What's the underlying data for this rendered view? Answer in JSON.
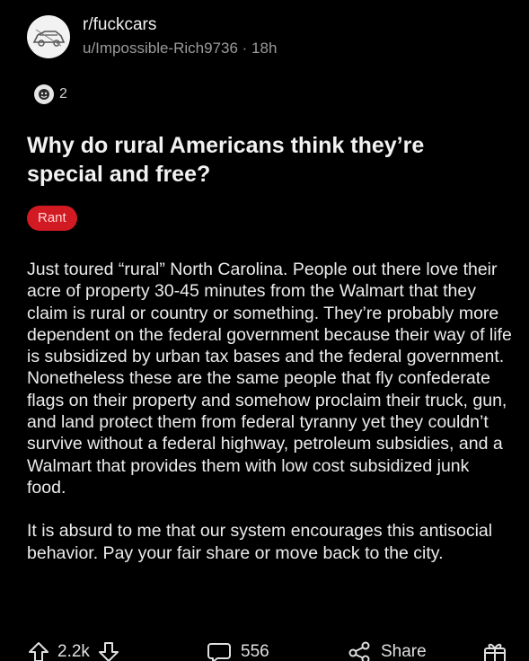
{
  "post": {
    "subreddit": "r/fuckcars",
    "byline": "u/Impossible-Rich9736 · 18h",
    "award_count": "2",
    "title": "Why do rural Americans think they’re special and free?",
    "flair": "Rant",
    "paragraphs": [
      "Just toured “rural” North Carolina.  People out there love their acre of property 30-45 minutes from the Walmart that they claim is rural or country or something.  They’re probably more dependent on the federal government because their way of life is subsidized by urban tax bases and the federal government. Nonetheless these are the same people that fly confederate flags on their property and somehow proclaim their truck, gun, and land protect them from federal tyranny yet they couldn’t survive without a federal highway, petroleum subsidies, and a Walmart that provides them with low cost subsidized junk food.",
      "It is absurd to me that our system encourages this antisocial behavior. Pay your fair share or move back to the city."
    ]
  },
  "actions": {
    "vote_score": "2.2k",
    "comment_count": "556",
    "share_label": "Share"
  },
  "colors": {
    "background": "#000000",
    "flair_bg": "#d11a22",
    "muted_text": "#9a9a9a"
  }
}
